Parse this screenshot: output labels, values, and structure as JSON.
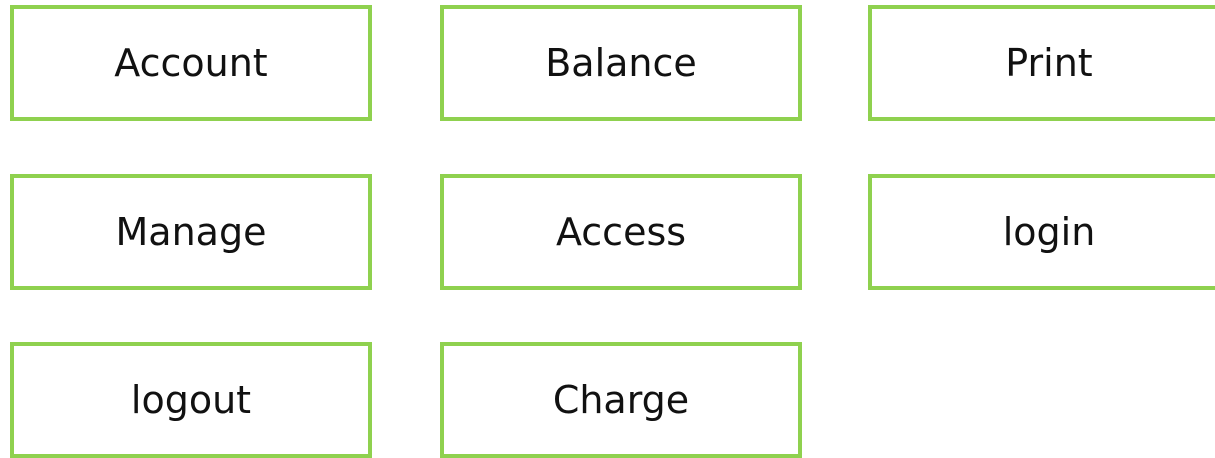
{
  "buttons": {
    "account": "Account",
    "balance": "Balance",
    "print": "Print",
    "manage": "Manage",
    "access": "Access",
    "login": "login",
    "logout": "logout",
    "charge": "Charge"
  },
  "colors": {
    "border": "#8fd14f",
    "background": "#ffffff",
    "text": "#111111"
  }
}
